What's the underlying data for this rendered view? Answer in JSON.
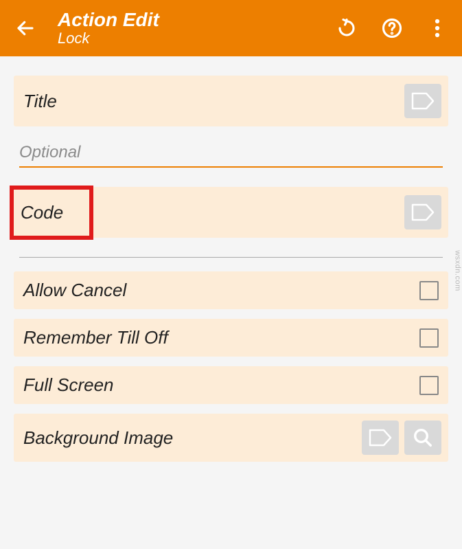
{
  "header": {
    "title": "Action Edit",
    "subtitle": "Lock"
  },
  "sections": {
    "title": {
      "label": "Title"
    },
    "title_input": {
      "placeholder": "Optional",
      "value": ""
    },
    "code": {
      "label": "Code"
    },
    "allow_cancel": {
      "label": "Allow Cancel",
      "checked": false
    },
    "remember": {
      "label": "Remember Till Off",
      "checked": false
    },
    "full_screen": {
      "label": "Full Screen",
      "checked": false
    },
    "bg_image": {
      "label": "Background Image"
    }
  },
  "watermark": "wsxdn.com"
}
